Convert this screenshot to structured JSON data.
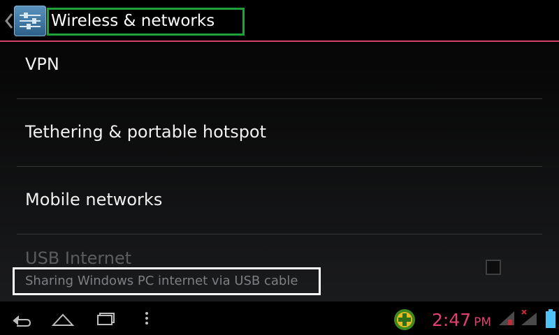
{
  "action_bar": {
    "title": "Wireless & networks",
    "up_icon": "chevron-left-icon",
    "app_icon": "settings-sliders-icon",
    "accent_color": "#d6416b",
    "title_highlight_color": "#1fa23b"
  },
  "settings": {
    "items": [
      {
        "title": "VPN"
      },
      {
        "title": "Tethering & portable hotspot"
      },
      {
        "title": "Mobile networks"
      },
      {
        "title": "USB Internet",
        "summary": "Sharing Windows PC internet via USB cable",
        "enabled": false,
        "checked": false
      }
    ]
  },
  "system_bar": {
    "time": "2:47",
    "ampm": "PM",
    "clock_color": "#e0426f",
    "nav_icons": [
      "back-icon",
      "home-icon",
      "recent-apps-icon",
      "menu-icon"
    ],
    "status_icons": [
      "notification-icon",
      "signal-icon",
      "signal-no-service-icon",
      "battery-icon"
    ]
  }
}
